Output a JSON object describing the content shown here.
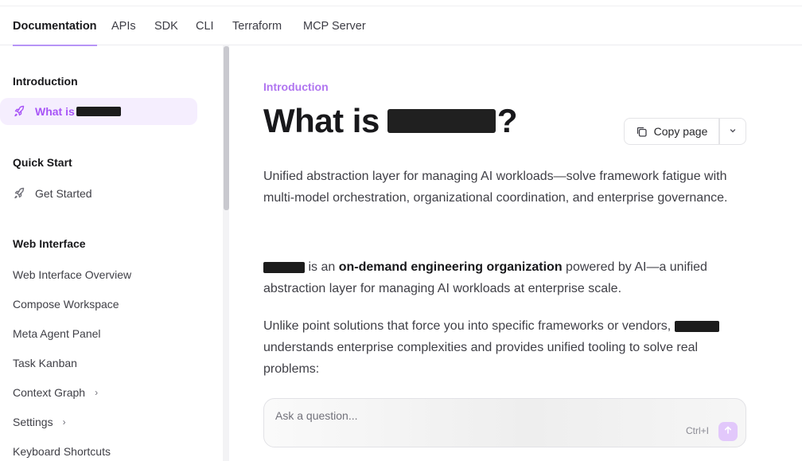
{
  "topnav": {
    "tabs": [
      {
        "label": "Documentation",
        "active": true
      },
      {
        "label": "APIs"
      },
      {
        "label": "SDK"
      },
      {
        "label": "CLI"
      },
      {
        "label": "Terraform"
      },
      {
        "label": "MCP Server"
      }
    ]
  },
  "sidebar": {
    "sections": {
      "introduction": "Introduction",
      "quick_start": "Quick Start",
      "web_interface": "Web Interface"
    },
    "items": {
      "what_is": "What is",
      "get_started": "Get Started",
      "web_interface_overview": "Web Interface Overview",
      "compose_workspace": "Compose Workspace",
      "meta_agent_panel": "Meta Agent Panel",
      "task_kanban": "Task Kanban",
      "context_graph": "Context Graph",
      "settings": "Settings",
      "keyboard_shortcuts": "Keyboard Shortcuts"
    },
    "active_color": "#a855f7"
  },
  "content": {
    "eyebrow": "Introduction",
    "title_prefix": "What is",
    "title_suffix": "?",
    "copy_page_label": "Copy page",
    "para1": "Unified abstraction layer for managing AI workloads—solve framework fatigue with multi-model orchestration, organizational coordination, and enterprise governance.",
    "para2_mid": " is an ",
    "para2_bold": "on-demand engineering organization",
    "para2_end": " powered by AI—a unified abstraction layer for managing AI workloads at enterprise scale.",
    "para3_start": "Unlike point solutions that force you into specific frameworks or vendors, ",
    "para3_end": " understands enterprise complexities and provides unified tooling to solve real problems:",
    "ask": {
      "placeholder": "Ask a question...",
      "shortcut": "Ctrl+I"
    }
  },
  "colors": {
    "accent": "#b075f0",
    "active_bg": "#f5eefe"
  }
}
